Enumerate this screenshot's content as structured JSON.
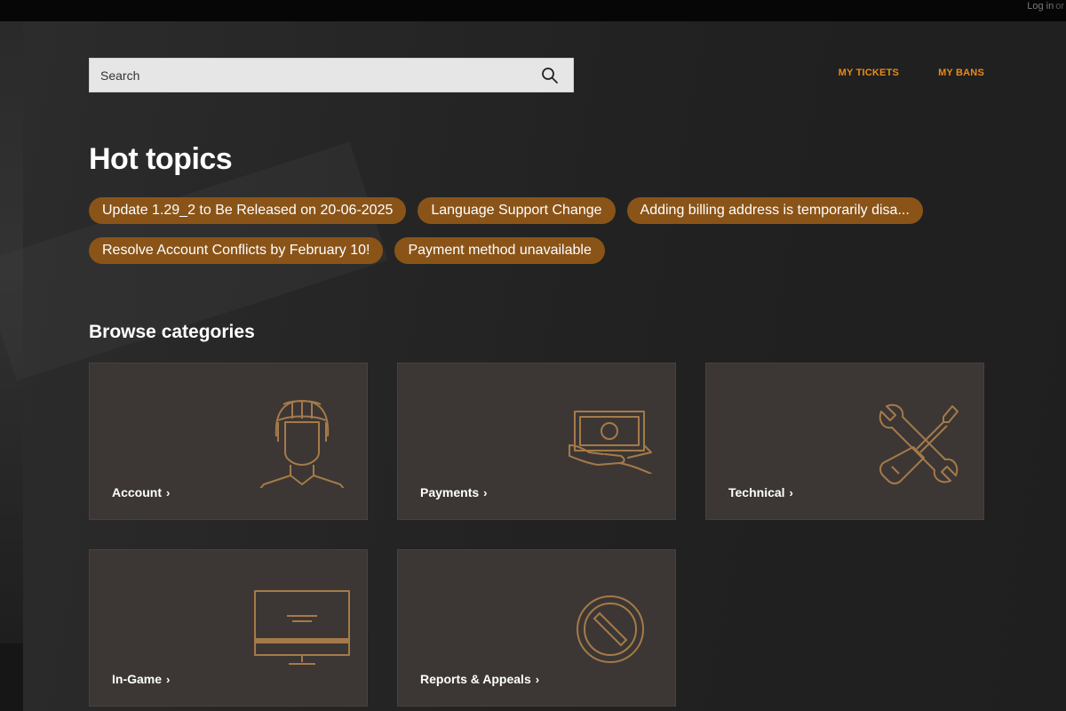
{
  "top_bar": {
    "login": "Log in",
    "or": "or"
  },
  "search": {
    "placeholder": "Search"
  },
  "nav": {
    "my_tickets": "MY TICKETS",
    "my_bans": "MY BANS"
  },
  "hot_topics": {
    "title": "Hot topics",
    "items": [
      "Update 1.29_2 to Be Released on 20-06-2025",
      "Language Support Change",
      "Adding billing address is temporarily disa...",
      "Resolve Account Conflicts by February 10!",
      "Payment method unavailable"
    ]
  },
  "browse": {
    "title": "Browse categories",
    "categories": [
      {
        "label": "Account",
        "icon": "helmet-person-icon"
      },
      {
        "label": "Payments",
        "icon": "hand-money-icon"
      },
      {
        "label": "Technical",
        "icon": "wrench-screwdriver-icon"
      },
      {
        "label": "In-Game",
        "icon": "monitor-icon"
      },
      {
        "label": "Reports & Appeals",
        "icon": "prohibited-icon"
      }
    ],
    "chevron": "›"
  },
  "colors": {
    "accent": "#e88a1a",
    "pill": "#8a5418",
    "card": "#3c3734",
    "icon": "#a57a4a"
  }
}
